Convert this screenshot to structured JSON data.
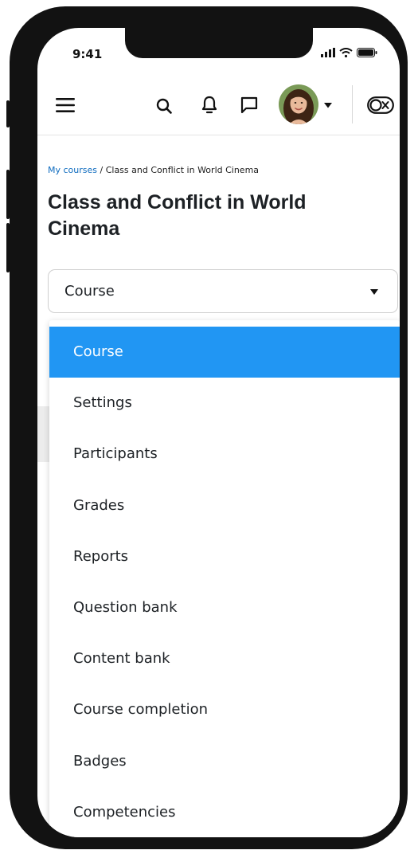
{
  "status_bar": {
    "time": "9:41"
  },
  "navbar": {
    "icons": [
      "menu-icon",
      "search-icon",
      "notification-bell-icon",
      "message-icon",
      "avatar",
      "chevron-down-icon",
      "reader-mode-toggle-icon"
    ]
  },
  "breadcrumb": {
    "link": "My courses",
    "separator": " / ",
    "current": "Class and Conflict in World Cinema"
  },
  "page": {
    "title": "Class and Conflict in World Cinema"
  },
  "course_select": {
    "selected": "Course",
    "options": [
      {
        "label": "Course",
        "selected": true
      },
      {
        "label": "Settings"
      },
      {
        "label": "Participants"
      },
      {
        "label": "Grades"
      },
      {
        "label": "Reports"
      },
      {
        "label": "Question bank"
      },
      {
        "label": "Content bank"
      },
      {
        "label": "Course completion"
      },
      {
        "label": "Badges"
      },
      {
        "label": "Competencies"
      }
    ]
  },
  "colors": {
    "accent": "#2196f3",
    "link": "#0f6cbf",
    "frame": "#121212"
  }
}
